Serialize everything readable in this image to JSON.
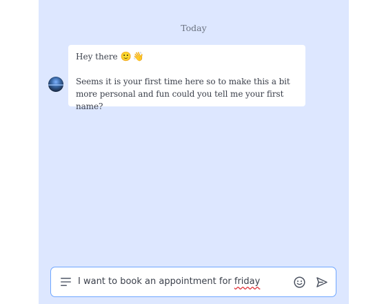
{
  "conversation": {
    "date_divider": "Today",
    "messages": [
      {
        "sender": "bot",
        "greeting": "Hey there",
        "greeting_emojis": [
          "🙂",
          "👋"
        ],
        "body": "Seems it is your first time here so to make this a bit more personal and fun could you tell me your first name?"
      }
    ]
  },
  "composer": {
    "text_prefix": "I want to book an appointment for ",
    "text_misspelled": "friday",
    "menu_icon": "menu-icon",
    "emoji_icon": "smiley-icon",
    "send_icon": "send-icon",
    "border_color": "#6ea6ff"
  },
  "colors": {
    "chat_background": "#dde7ff",
    "bubble_background": "#ffffff",
    "text": "#3a3f4a",
    "spellcheck_underline": "#e0323a"
  }
}
